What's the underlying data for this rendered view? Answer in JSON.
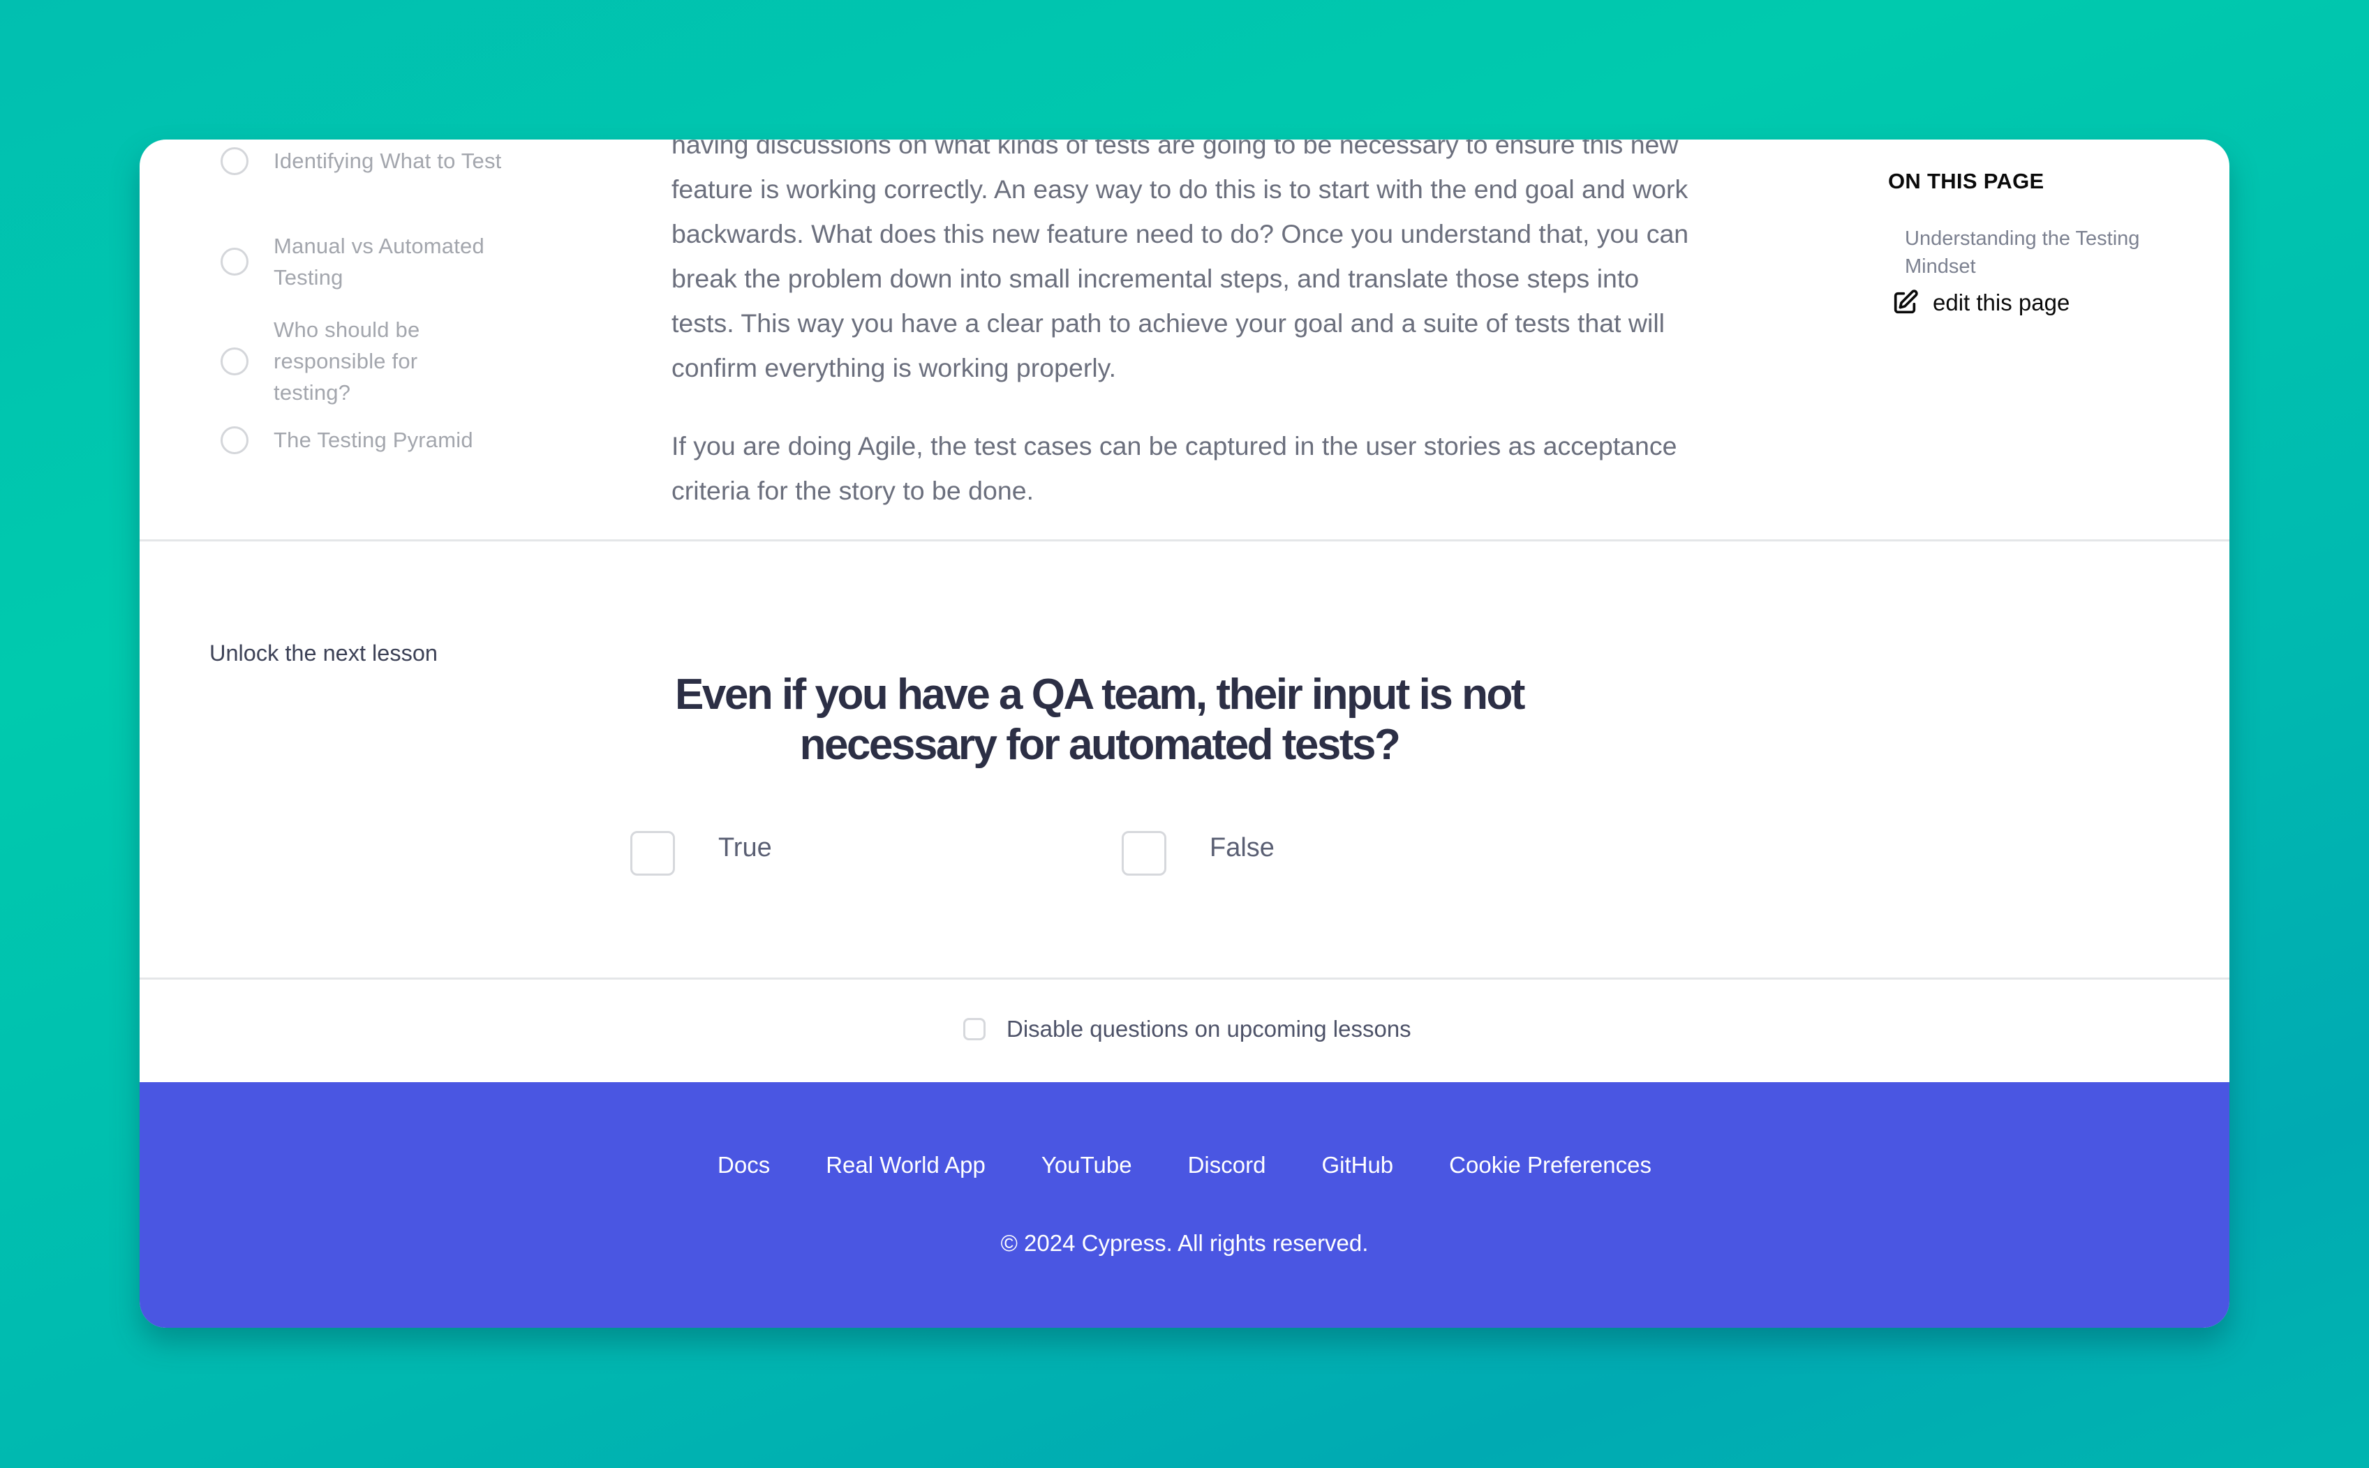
{
  "sidebar": {
    "items": [
      {
        "label": "Identifying What to Test"
      },
      {
        "label": "Manual vs Automated Testing"
      },
      {
        "label": "Who should be responsible for testing?"
      },
      {
        "label": "The Testing Pyramid"
      }
    ]
  },
  "article": {
    "paragraphs": [
      "having discussions on what kinds of tests are going to be necessary to ensure this new feature is working correctly. An easy way to do this is to start with the end goal and work backwards. What does this new feature need to do? Once you understand that, you can break the problem down into small incremental steps, and translate those steps into tests. This way you have a clear path to achieve your goal and a suite of tests that will confirm everything is working properly.",
      "If you are doing Agile, the test cases can be captured in the user stories as acceptance criteria for the story to be done."
    ]
  },
  "toc": {
    "title": "ON THIS PAGE",
    "items": [
      {
        "label": "Understanding the Testing Mindset"
      }
    ],
    "edit_label": "edit this page"
  },
  "quiz": {
    "unlock_label": "Unlock the next lesson",
    "question": "Even if you have a QA team, their input is not necessary for automated tests?",
    "options": [
      {
        "label": "True",
        "checked": false
      },
      {
        "label": "False",
        "checked": false
      }
    ],
    "disable_label": "Disable questions on upcoming lessons",
    "disable_checked": false
  },
  "footer": {
    "links": [
      {
        "label": "Docs"
      },
      {
        "label": "Real World App"
      },
      {
        "label": "YouTube"
      },
      {
        "label": "Discord"
      },
      {
        "label": "GitHub"
      },
      {
        "label": "Cookie Preferences"
      }
    ],
    "copyright": "© 2024 Cypress. All rights reserved."
  },
  "colors": {
    "footer_bg": "#4a56e2",
    "heading": "#2c2f45",
    "body_text": "#6b6f7d",
    "muted_text": "#a3a6ad"
  }
}
